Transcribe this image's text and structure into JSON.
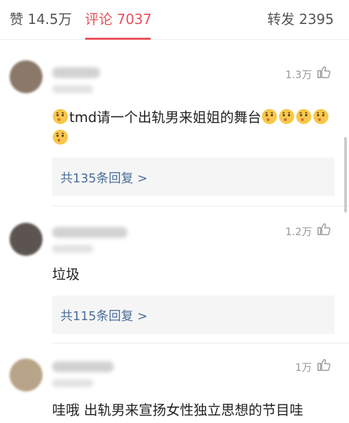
{
  "tabs": {
    "likes": "赞 14.5万",
    "comments": "评论 7037",
    "reposts": "转发 2395"
  },
  "comments": [
    {
      "likes": "1.3万",
      "text_prefix": "tmd请一个出轨男来姐姐的舞台",
      "reply_label": "共135条回复 >"
    },
    {
      "likes": "1.2万",
      "text": "垃圾",
      "reply_label": "共115条回复 >"
    },
    {
      "likes": "1万",
      "text": "哇哦 出轨男来宣扬女性独立思想的节目哇"
    }
  ],
  "icons": {
    "like": "thumbs-up-icon",
    "emoji": "thinking-face-emoji"
  },
  "colors": {
    "accent": "#e8505b",
    "link": "#4a6d9a"
  }
}
